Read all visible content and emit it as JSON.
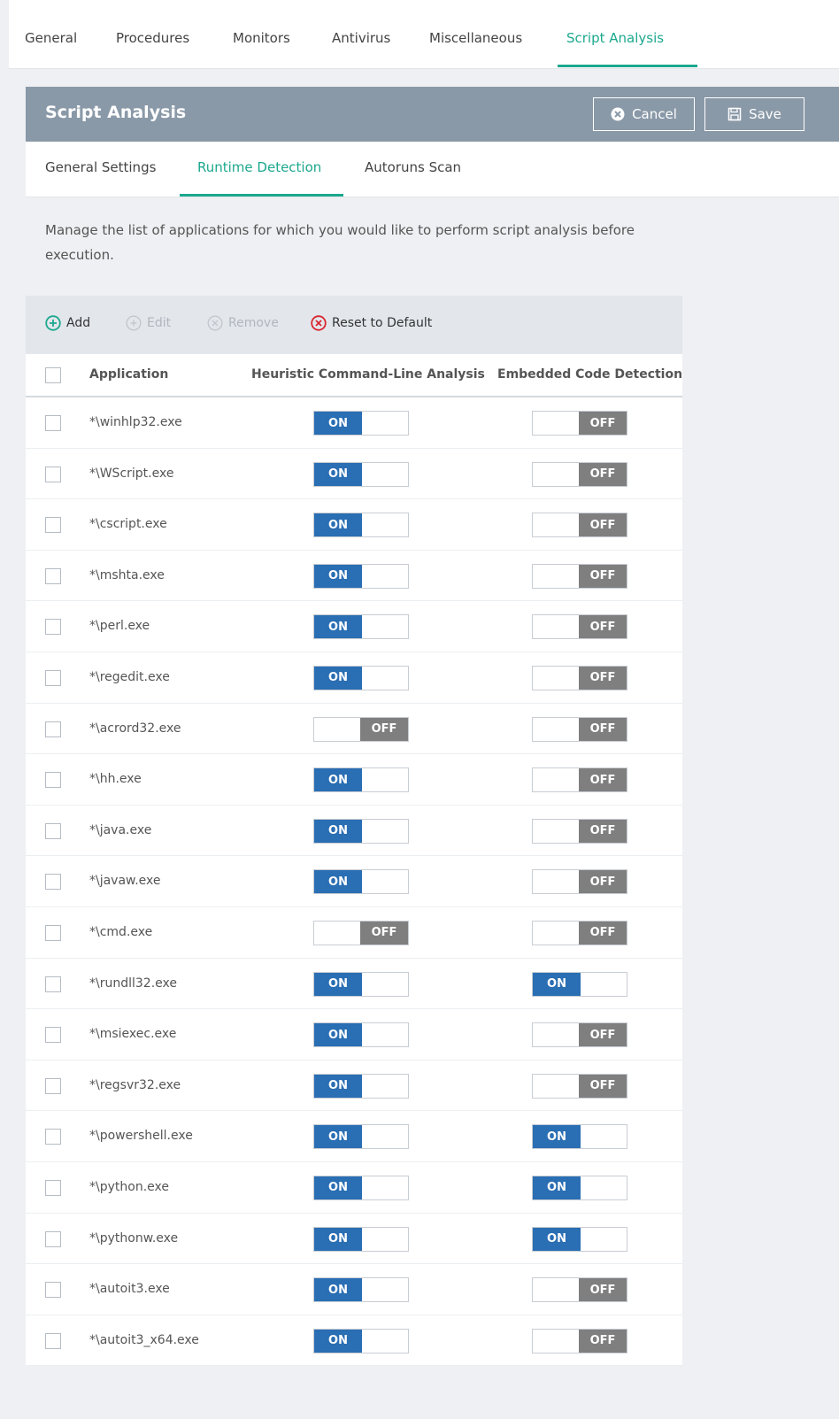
{
  "top_tabs": [
    "General",
    "Procedures",
    "Monitors",
    "Antivirus",
    "Miscellaneous",
    "Script Analysis"
  ],
  "panel": {
    "title": "Script Analysis",
    "cancel_label": "Cancel",
    "save_label": "Save"
  },
  "sub_tabs": [
    "General Settings",
    "Runtime Detection",
    "Autoruns Scan"
  ],
  "description": "Manage the list of applications for which you would like to perform script analysis before execution.",
  "toolbar": {
    "add": "Add",
    "edit": "Edit",
    "remove": "Remove",
    "reset": "Reset to Default"
  },
  "table": {
    "headers": [
      "Application",
      "Heuristic Command-Line Analysis",
      "Embedded Code Detection"
    ],
    "rows": [
      {
        "app": "*\\winhlp32.exe",
        "heuristic": "ON",
        "embedded": "OFF"
      },
      {
        "app": "*\\WScript.exe",
        "heuristic": "ON",
        "embedded": "OFF"
      },
      {
        "app": "*\\cscript.exe",
        "heuristic": "ON",
        "embedded": "OFF"
      },
      {
        "app": "*\\mshta.exe",
        "heuristic": "ON",
        "embedded": "OFF"
      },
      {
        "app": "*\\perl.exe",
        "heuristic": "ON",
        "embedded": "OFF"
      },
      {
        "app": "*\\regedit.exe",
        "heuristic": "ON",
        "embedded": "OFF"
      },
      {
        "app": "*\\acrord32.exe",
        "heuristic": "OFF",
        "embedded": "OFF"
      },
      {
        "app": "*\\hh.exe",
        "heuristic": "ON",
        "embedded": "OFF"
      },
      {
        "app": "*\\java.exe",
        "heuristic": "ON",
        "embedded": "OFF"
      },
      {
        "app": "*\\javaw.exe",
        "heuristic": "ON",
        "embedded": "OFF"
      },
      {
        "app": "*\\cmd.exe",
        "heuristic": "OFF",
        "embedded": "OFF"
      },
      {
        "app": "*\\rundll32.exe",
        "heuristic": "ON",
        "embedded": "ON"
      },
      {
        "app": "*\\msiexec.exe",
        "heuristic": "ON",
        "embedded": "OFF"
      },
      {
        "app": "*\\regsvr32.exe",
        "heuristic": "ON",
        "embedded": "OFF"
      },
      {
        "app": "*\\powershell.exe",
        "heuristic": "ON",
        "embedded": "ON"
      },
      {
        "app": "*\\python.exe",
        "heuristic": "ON",
        "embedded": "ON"
      },
      {
        "app": "*\\pythonw.exe",
        "heuristic": "ON",
        "embedded": "ON"
      },
      {
        "app": "*\\autoit3.exe",
        "heuristic": "ON",
        "embedded": "OFF"
      },
      {
        "app": "*\\autoit3_x64.exe",
        "heuristic": "ON",
        "embedded": "OFF"
      }
    ]
  },
  "colors": {
    "accent": "#1ca88e",
    "header_bg": "#8a99a8",
    "toggle_on": "#2a6eb3",
    "toggle_off": "#7f7f7f",
    "add_icon": "#1ca88e",
    "reset_icon": "#d9262f"
  }
}
